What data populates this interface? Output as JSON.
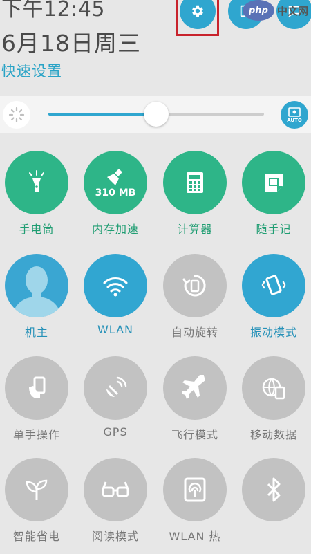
{
  "status": {
    "time": "下午12:45",
    "date": "6月18日周三"
  },
  "quick_settings_title": "快速设置",
  "watermark": {
    "logo": "php",
    "site": "中文网"
  },
  "brightness": {
    "level_percent": 50,
    "auto_label": "AUTO"
  },
  "accent_colors": {
    "green": "#2eb588",
    "blue": "#31a6d1",
    "off": "#c2c2c2",
    "highlight": "#c8232c"
  },
  "tiles": [
    {
      "label": "手电筒",
      "icon": "flashlight-icon",
      "state": "on"
    },
    {
      "label": "内存加速",
      "icon": "broom-icon",
      "state": "on",
      "badge": "310 MB"
    },
    {
      "label": "计算器",
      "icon": "calculator-icon",
      "state": "on"
    },
    {
      "label": "随手记",
      "icon": "note-icon",
      "state": "on"
    },
    {
      "label": "机主",
      "icon": "avatar-icon",
      "state": "on"
    },
    {
      "label": "WLAN",
      "icon": "wifi-icon",
      "state": "on"
    },
    {
      "label": "自动旋转",
      "icon": "rotate-icon",
      "state": "off"
    },
    {
      "label": "振动模式",
      "icon": "vibrate-icon",
      "state": "on"
    },
    {
      "label": "单手操作",
      "icon": "one-hand-icon",
      "state": "off"
    },
    {
      "label": "GPS",
      "icon": "gps-icon",
      "state": "off"
    },
    {
      "label": "飞行模式",
      "icon": "airplane-icon",
      "state": "off"
    },
    {
      "label": "移动数据",
      "icon": "mobile-data-icon",
      "state": "off"
    },
    {
      "label": "智能省电",
      "icon": "leaf-icon",
      "state": "off"
    },
    {
      "label": "阅读模式",
      "icon": "glasses-icon",
      "state": "off"
    },
    {
      "label": "WLAN 热",
      "icon": "hotspot-icon",
      "state": "off"
    },
    {
      "label": "",
      "icon": "bluetooth-icon",
      "state": "off"
    }
  ]
}
